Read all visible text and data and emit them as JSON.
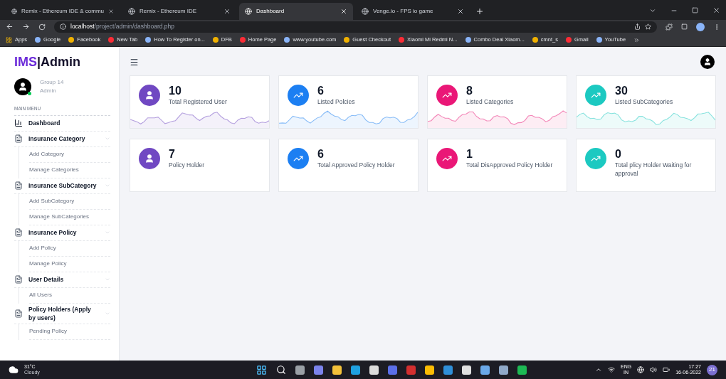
{
  "browser": {
    "tabs": [
      {
        "title": "Remix - Ethereum IDE & commu",
        "selected": false
      },
      {
        "title": "Remix - Ethereum IDE",
        "selected": false
      },
      {
        "title": "Dashboard",
        "selected": true
      },
      {
        "title": "Venge.io - FPS io game",
        "selected": false
      }
    ],
    "address": {
      "host": "localhost",
      "path": "/project/admin/dashboard.php"
    },
    "bookmarks": [
      "Apps",
      "Google",
      "Facebook",
      "New Tab",
      "How To Register on...",
      "DFB",
      "Home Page",
      "www.youtube.com",
      "Guest Checkout",
      "Xiaomi Mi Redmi N...",
      "Combo Deal Xiaom...",
      "cmnt_s",
      "Gmail",
      "YouTube"
    ]
  },
  "sidebar": {
    "logo_accent": "IMS",
    "logo_separator": "|",
    "logo_rest": "Admin",
    "user": {
      "name": "Group 14",
      "role": "Admin",
      "online": true
    },
    "section": "MAIN MENU",
    "items": [
      {
        "label": "Dashboard",
        "kind": "link"
      },
      {
        "label": "Insurance Category",
        "kind": "group",
        "expanded": true,
        "children": [
          {
            "label": "Add Category"
          },
          {
            "label": "Manage Categories"
          }
        ]
      },
      {
        "label": "Insurance SubCategory",
        "kind": "group",
        "expanded": true,
        "children": [
          {
            "label": "Add SubCategory"
          },
          {
            "label": "Manage SubCategories"
          }
        ]
      },
      {
        "label": "Insurance Policy",
        "kind": "group",
        "expanded": true,
        "children": [
          {
            "label": "Add Policy"
          },
          {
            "label": "Manage Policy"
          }
        ]
      },
      {
        "label": "User Details",
        "kind": "group",
        "expanded": true,
        "children": [
          {
            "label": "All Users"
          }
        ]
      },
      {
        "label": "Policy Holders (Apply by users)",
        "kind": "group",
        "expanded": true,
        "children": [
          {
            "label": "Pending Policy"
          }
        ]
      }
    ]
  },
  "cards": [
    {
      "value": "10",
      "label": "Total Registered User",
      "kind": "user",
      "color": "#7048c2",
      "sparkline": true
    },
    {
      "value": "6",
      "label": "Listed Polcies",
      "kind": "chart",
      "color": "#1c7ff2",
      "sparkline": true
    },
    {
      "value": "8",
      "label": "Listed Categories",
      "kind": "chart",
      "color": "#ea1777",
      "sparkline": true
    },
    {
      "value": "30",
      "label": "Listed SubCategories",
      "kind": "chart",
      "color": "#1cc9c1",
      "sparkline": true
    },
    {
      "value": "7",
      "label": "Policy Holder",
      "kind": "user",
      "color": "#7048c2",
      "sparkline": false
    },
    {
      "value": "6",
      "label": "Total Approved Policy Holder",
      "kind": "chart",
      "color": "#1c7ff2",
      "sparkline": false
    },
    {
      "value": "1",
      "label": "Total DisApproved Policy Holder",
      "kind": "chart",
      "color": "#ea1777",
      "sparkline": false
    },
    {
      "value": "0",
      "label": "Total plicy Holder Waiting for approval",
      "kind": "chart",
      "color": "#1cc9c1",
      "sparkline": false
    }
  ],
  "taskbar": {
    "temperature": "31°C",
    "weather": "Cloudy",
    "language": "ENG",
    "region": "IN",
    "time": "17:27",
    "date": "16-06-2022",
    "notifications": "21"
  }
}
